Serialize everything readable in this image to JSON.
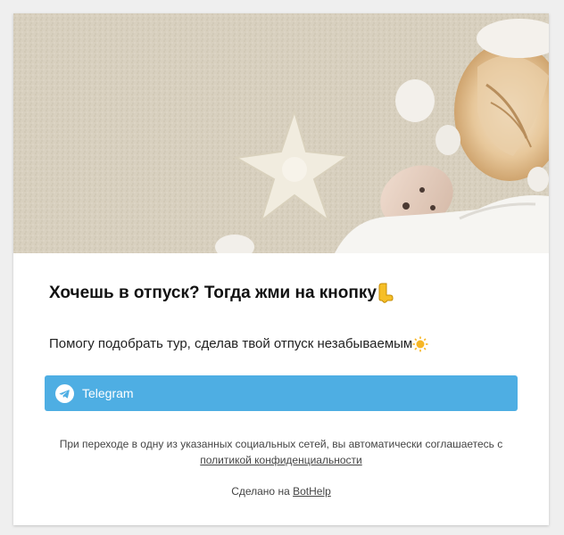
{
  "widget": {
    "hero_image": "beach-sand-seashells-starfish",
    "title": "Хочешь в отпуск? Тогда жми на кнопку",
    "title_emoji": "pointing-down-hand",
    "description": "Помогу подобрать тур, сделав твой отпуск незабываемым",
    "description_emoji": "sun",
    "button": {
      "label": "Telegram",
      "icon": "telegram-icon",
      "color": "#4eaee3"
    },
    "consent": {
      "text": "При переходе в одну из указанных социальных сетей, вы автоматически соглашаетесь с",
      "link_label": "политикой конфиденциальности"
    },
    "made_with": {
      "prefix": "Сделано на",
      "link_label": "BotHelp"
    }
  },
  "colors": {
    "page_background": "#efefef",
    "card_background": "#ffffff",
    "accent": "#4eaee3"
  }
}
